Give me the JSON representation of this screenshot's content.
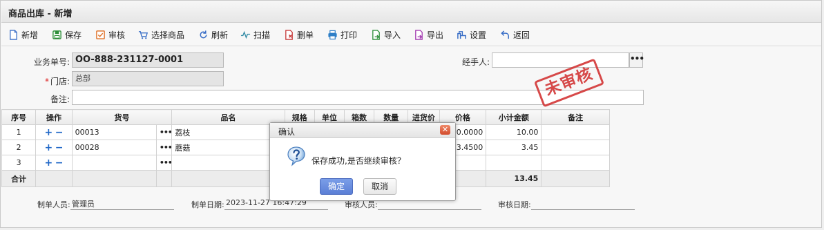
{
  "window": {
    "title": "商品出库 - 新增"
  },
  "toolbar": {
    "items": [
      {
        "label": "新增",
        "icon": "new-doc-icon",
        "color": "#3a6fc7"
      },
      {
        "label": "保存",
        "icon": "save-icon",
        "color": "#2f8f3a"
      },
      {
        "label": "审核",
        "icon": "check-box-icon",
        "color": "#e0752d"
      },
      {
        "label": "选择商品",
        "icon": "cart-icon",
        "color": "#3a6fc7"
      },
      {
        "label": "刷新",
        "icon": "refresh-icon",
        "color": "#3a6fc7"
      },
      {
        "label": "扫描",
        "icon": "scan-icon",
        "color": "#3a8fa8"
      },
      {
        "label": "删单",
        "icon": "delete-doc-icon",
        "color": "#c73a3a"
      },
      {
        "label": "打印",
        "icon": "print-icon",
        "color": "#2f7fc7"
      },
      {
        "label": "导入",
        "icon": "import-icon",
        "color": "#2f8f3a"
      },
      {
        "label": "导出",
        "icon": "export-icon",
        "color": "#a23ab0"
      },
      {
        "label": "设置",
        "icon": "settings-icon",
        "color": "#3a6fc7"
      },
      {
        "label": "返回",
        "icon": "back-icon",
        "color": "#3a6fc7"
      }
    ]
  },
  "form": {
    "order_no_label": "业务单号:",
    "order_no_value": "OO-888-231127-0001",
    "store_label": "门店:",
    "store_required": "*",
    "store_value": "总部",
    "remark_label": "备注:",
    "remark_value": "",
    "handler_label": "经手人:",
    "handler_value": ""
  },
  "stamp": {
    "text": "未审核",
    "color": "#d43a3a"
  },
  "grid": {
    "headers": [
      "序号",
      "操作",
      "货号",
      "",
      "品名",
      "规格",
      "单位",
      "箱数",
      "数量",
      "进货价",
      "价格",
      "小计金额",
      "备注"
    ],
    "rows": [
      {
        "seq": "1",
        "code": "00013",
        "name": "荔枝",
        "price": "10.0000",
        "subtotal": "10.00"
      },
      {
        "seq": "2",
        "code": "00028",
        "name": "蘑菇",
        "price": "3.4500",
        "subtotal": "3.45"
      },
      {
        "seq": "3",
        "code": "",
        "name": "",
        "price": "",
        "subtotal": ""
      }
    ],
    "total_label": "合计",
    "total_amount": "13.45",
    "ops_plus": "+",
    "ops_minus": "−",
    "dots": "•••"
  },
  "footer": {
    "creator_label": "制单人员:",
    "creator_value": "管理员",
    "created_date_label": "制单日期:",
    "created_date_value": "2023-11-27 16:47:29",
    "reviewer_label": "审核人员:",
    "reviewer_value": "",
    "review_date_label": "审核日期:",
    "review_date_value": ""
  },
  "dialog": {
    "title": "确认",
    "icon": "question-icon",
    "message": "保存成功,是否继续审核？",
    "ok_label": "确定",
    "cancel_label": "取消",
    "close_symbol": "✕"
  }
}
